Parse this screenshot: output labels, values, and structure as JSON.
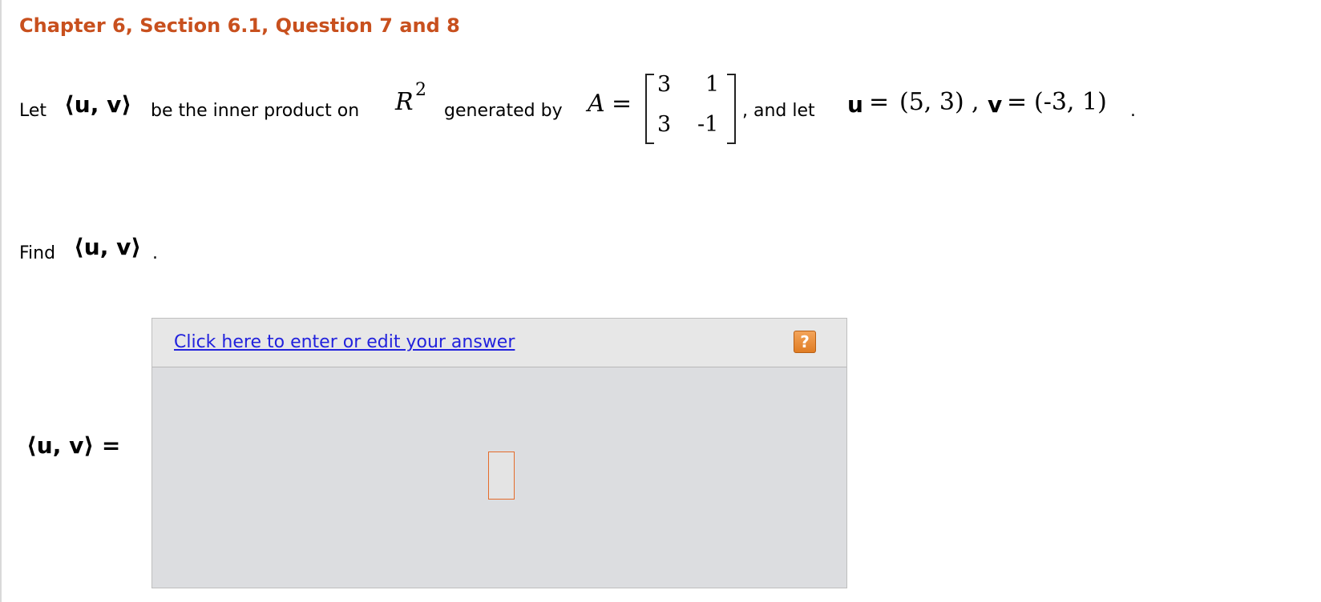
{
  "title": "Chapter 6, Section 6.1, Question 7 and 8",
  "problem": {
    "let": "Let",
    "inner_product": "⟨u, v⟩",
    "be_inner_product_on": "be the inner product on",
    "space": "R",
    "space_exp": "2",
    "generated_by": "generated by",
    "matrix_name": "A",
    "equals": "=",
    "matrix": [
      [
        "3",
        "1"
      ],
      [
        "3",
        "-1"
      ]
    ],
    "and_let": ", and let",
    "u_label": "u",
    "u_value": "(5, 3)",
    "v_label": "v",
    "v_value": "(-3, 1)",
    "comma": ",",
    "period": "."
  },
  "find": {
    "label": "Find",
    "expr": "⟨u, v⟩",
    "period": "."
  },
  "answer": {
    "lhs": "⟨u, v⟩ =",
    "link_text": "Click here to enter or edit your answer",
    "help_text": "?"
  },
  "colors": {
    "title": "#c8501e",
    "link": "#2222dd",
    "help_button": "#e8892f",
    "answer_panel": "#dcdde0",
    "input_border": "#e46b2a"
  }
}
